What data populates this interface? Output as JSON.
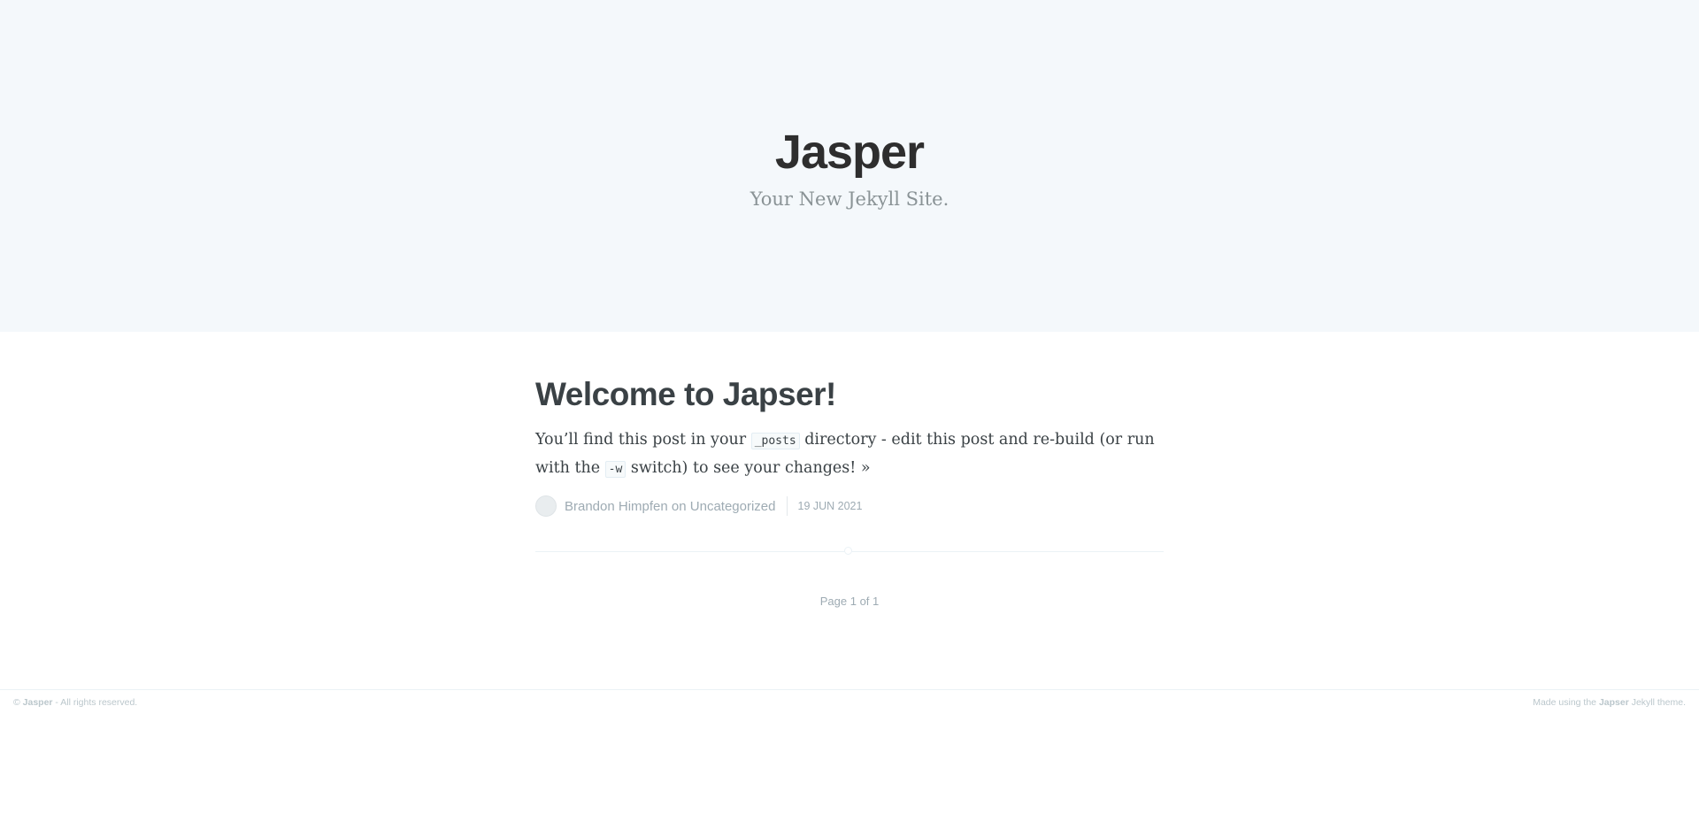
{
  "header": {
    "title": "Jasper",
    "description": "Your New Jekyll Site."
  },
  "post": {
    "title": "Welcome to Japser!",
    "excerpt_part1": "You’ll find this post in your ",
    "excerpt_code1": "_posts",
    "excerpt_part2": " directory - edit this post and re-build (or run with the ",
    "excerpt_code2": "-w",
    "excerpt_part3": " switch) to see your changes! ",
    "read_more": "»",
    "author": "Brandon Himpfen",
    "on_text": " on ",
    "category": "Uncategorized",
    "date": "19 JUN 2021"
  },
  "pagination": {
    "text": "Page 1 of 1"
  },
  "footer": {
    "copyright_symbol": "© ",
    "copyright_name": "Jasper",
    "copyright_rest": " - All rights reserved.",
    "powered_prefix": "Made using the ",
    "powered_name": "Japser",
    "powered_suffix": " Jekyll theme."
  }
}
